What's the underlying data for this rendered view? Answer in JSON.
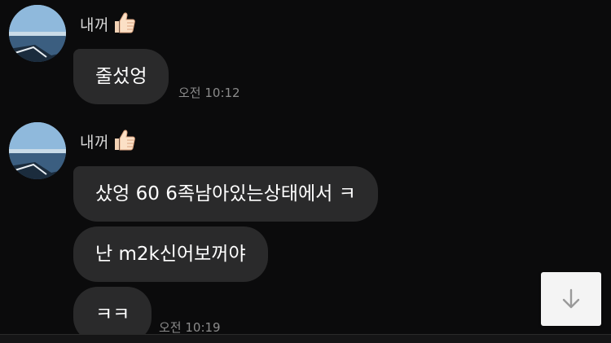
{
  "messages": {
    "group1": {
      "sender": "내꺼",
      "sender_emoji": "thumbs-up-icon",
      "bubbles": [
        {
          "text": "줄섰엉"
        }
      ],
      "time": "오전 10:12"
    },
    "group2": {
      "sender": "내꺼",
      "sender_emoji": "thumbs-up-icon",
      "bubbles": [
        {
          "text": "샀엉 60 6족남아있는상태에서 ㅋ"
        },
        {
          "text": "난 m2k신어보꺼야"
        },
        {
          "text": "ㅋㅋ"
        }
      ],
      "time": "오전 10:19"
    }
  },
  "scroll_button": {
    "icon": "arrow-down-icon"
  },
  "colors": {
    "background": "#0b0b0c",
    "bubble": "#2a2a2b",
    "text": "#ffffff",
    "timestamp": "#8b8b8b",
    "name": "#d6d6d6"
  }
}
